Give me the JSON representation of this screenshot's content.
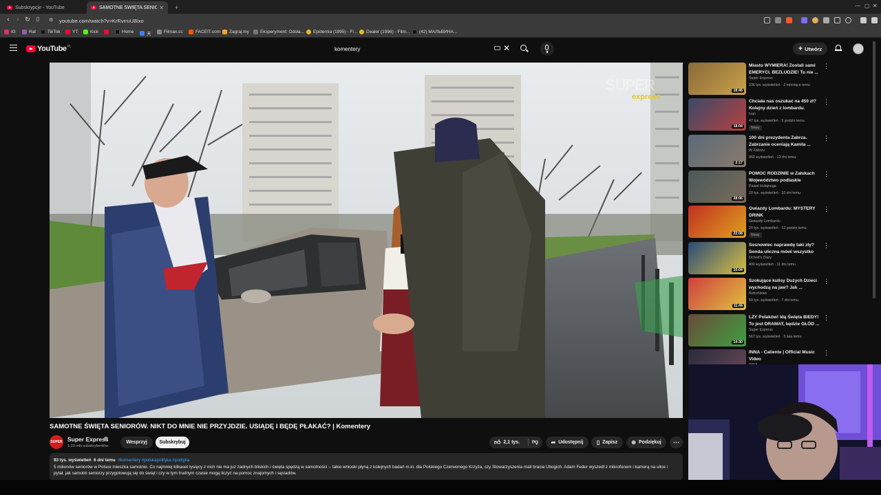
{
  "browser": {
    "tabs": [
      {
        "label": "Subskrypcje - YouTube"
      },
      {
        "label": "SAMOTNE ŚWIĘTA SENIORÓW"
      }
    ],
    "url": "youtube.com/watch?v=KrRvrruUBixo",
    "bookmarks": [
      {
        "label": "IG",
        "color": "#e1306c"
      },
      {
        "label": "Rat",
        "color": "#9b59b6"
      },
      {
        "label": "TikTok",
        "color": "#111111"
      },
      {
        "label": "YT",
        "color": "#ff0033"
      },
      {
        "label": "Kick",
        "color": "#53fc18"
      },
      {
        "label": "",
        "color": "#ff0033"
      },
      {
        "label": "Home",
        "color": "#000000"
      },
      {
        "label": "天",
        "color": "#3b82f6"
      },
      {
        "label": "Filman.cc",
        "color": "#888888"
      },
      {
        "label": "FACEIT.com",
        "color": "#ff5500"
      },
      {
        "label": "Zagraj.my",
        "color": "#f5a623"
      },
      {
        "label": "Eksperyment: Odsła...",
        "color": "#777777"
      },
      {
        "label": "Epidemia (1995) - Fi...",
        "color": "#e8b923"
      },
      {
        "label": "Dealer (1996) - Film...",
        "color": "#e8b923"
      },
      {
        "label": "(42) МАЛЬВИНА...",
        "color": "#111111"
      }
    ]
  },
  "masthead": {
    "logo": "YouTube",
    "logo_country": "PL",
    "search_value": "komentery",
    "create_label": "Utwórz"
  },
  "video": {
    "title": "SAMOTNE ŚWIĘTA SENIORÓW. NIKT DO MNIE NIE PRZYJDZIE. USIĄDĘ I BĘDĘ PŁAKAĆ? | Komentery",
    "watermark_top": "SUPER",
    "watermark_bottom": "express",
    "channel": {
      "name": "Super Express",
      "avatar_text": "SUPER",
      "subscribers": "1,23 mln subskrybentów",
      "join_label": "Wesprzyj",
      "subscribe_label": "Subskrybuj"
    },
    "actions": {
      "likes": "2,1 tys.",
      "share": "Udostępnij",
      "save": "Zapisz",
      "thanks": "Podziękuj"
    },
    "description": {
      "views": "93 tys. wyświetleń",
      "age": "6 dni temu",
      "tags": "#komentery #polskapolityka #polityka",
      "text": "5 milionów seniorów w Polsce mieszka samotnie. Co najmniej kilkaset tysięcy z nich nie ma już żadnych bliskich i święta spędzą w samotności -- takie wnioski płyną z kolejnych badań m.in. dla Polskiego Czerwonego Krzyża, czy Stowarzyszenia mali bracia Ubogich. Adam Feder wyszedł z mikrofonem i kamerą na ulice i pytał, jak samotni seniorzy przygotowują się do świąt i czy w tym trudnym czasie mogą liczyć na pomoc znajomych i sąsiadów."
    }
  },
  "recommendations": [
    {
      "title": "Miasto WYMIERA! Zostali sami EMERYCI. BEZLUDZIE! Tu nie ...",
      "channel": "Super Express",
      "verified": true,
      "meta": "236 tys. wyświetleń · 2 miesiące temu",
      "duration": "18:46",
      "badge": "",
      "colors": [
        "#8a6a3a",
        "#c9a24a"
      ]
    },
    {
      "title": "Chciała nas oszukać na 450 zł? Kolejny dzień z lombardu.",
      "channel": "Ivan",
      "verified": false,
      "meta": "47 tys. wyświetleń · 9 godzin temu",
      "duration": "18:04",
      "badge": "Nowy",
      "colors": [
        "#3a4a6a",
        "#b84040"
      ]
    },
    {
      "title": "100 dni prezydenta Zabrza. Zabrzanie oceniają Kamila ...",
      "channel": "W Zabrzu",
      "verified": false,
      "meta": "960 wyświetleń · 13 dni temu",
      "duration": "2:17",
      "badge": "",
      "colors": [
        "#5a6a7a",
        "#8a7a6a"
      ]
    },
    {
      "title": "POMOC RODZINIE w Załukach Województwo podlaskie",
      "channel": "Paweł Hulajnoga",
      "verified": false,
      "meta": "20 tys. wyświetleń · 10 dni temu",
      "duration": "28:06",
      "badge": "",
      "colors": [
        "#4a5a5a",
        "#7a6a5a"
      ]
    },
    {
      "title": "Gwiazdy Lombardu: MYSTERY DRINK",
      "channel": "Gwiazdy Lombardu",
      "verified": false,
      "meta": "20 tys. wyświetleń · 12 godzin temu",
      "duration": "22:08",
      "badge": "Nowy",
      "colors": [
        "#c03020",
        "#e0a020"
      ]
    },
    {
      "title": "Sosnowiec naprawdę taki zły? Sonda uliczna mówi wszystko",
      "channel": "Ochrid's Diary",
      "verified": false,
      "meta": "400 wyświetleń · 11 dni temu",
      "duration": "10:04",
      "badge": "",
      "colors": [
        "#2a4a7a",
        "#d8c040"
      ]
    },
    {
      "title": "Szokujące kulisy Dużych Dzieci wychodzą na jaw? Jak ...",
      "channel": "RetroNews",
      "verified": false,
      "meta": "59 tys. wyświetleń · 7 dni temu",
      "duration": "11:44",
      "badge": "",
      "colors": [
        "#d04040",
        "#e0c040"
      ]
    },
    {
      "title": "LZY Polaków! Idą Święta BIEDY! To jest DRAMAT, będzie GŁÓD ...",
      "channel": "Super Express",
      "verified": true,
      "meta": "567 tys. wyświetleń · 3 lata temu",
      "duration": "14:30",
      "badge": "",
      "colors": [
        "#6a4a3a",
        "#40a040"
      ]
    },
    {
      "title": "INNA - Caliente | Official Music Video",
      "channel": "INNA",
      "verified": false,
      "meta": "",
      "duration": "",
      "badge": "",
      "colors": [
        "#2a2a3a",
        "#6a4a5a"
      ]
    }
  ]
}
